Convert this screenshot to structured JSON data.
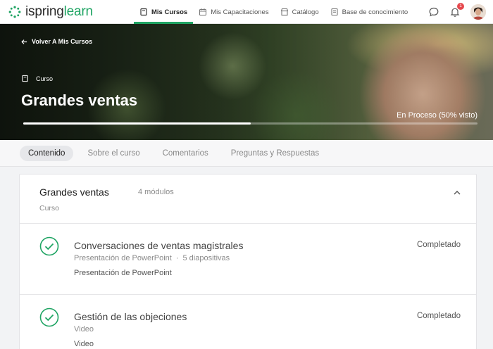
{
  "brand": {
    "name_part1": "ispring",
    "name_part2": "learn",
    "accent": "#1fa463"
  },
  "nav": {
    "items": [
      {
        "label": "Mis Cursos",
        "icon": "book-icon",
        "active": true
      },
      {
        "label": "Mis Capacitaciones",
        "icon": "calendar-icon",
        "active": false
      },
      {
        "label": "Catálogo",
        "icon": "store-icon",
        "active": false
      },
      {
        "label": "Base de conocimiento",
        "icon": "knowledge-icon",
        "active": false
      }
    ],
    "notifications_count": "1"
  },
  "hero": {
    "back_label": "Volver A Mis Cursos",
    "type_label": "Curso",
    "title": "Grandes ventas",
    "progress_label": "En Proceso (50% visto)",
    "progress_fraction": 0.5
  },
  "tabs": [
    {
      "label": "Contenido",
      "active": true
    },
    {
      "label": "Sobre el curso",
      "active": false
    },
    {
      "label": "Comentarios",
      "active": false
    },
    {
      "label": "Preguntas y Respuestas",
      "active": false
    }
  ],
  "course": {
    "title": "Grandes ventas",
    "modules": "4 módulos",
    "type": "Curso",
    "items": [
      {
        "title": "Conversaciones de ventas magistrales",
        "meta_type": "Presentación de PowerPoint",
        "meta_sep": "·",
        "meta_extra": "5 diapositivas",
        "description": "Presentación de PowerPoint",
        "status": "Completado"
      },
      {
        "title": "Gestión de las objeciones",
        "meta_type": "Video",
        "meta_sep": "",
        "meta_extra": "",
        "description": "Video",
        "status": "Completado"
      }
    ]
  }
}
